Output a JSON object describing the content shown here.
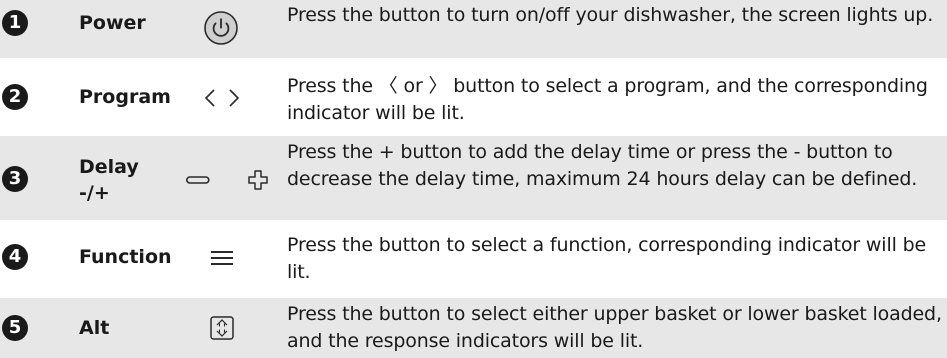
{
  "rows": [
    {
      "number": "1",
      "name": "Power",
      "icon": "power-icon",
      "description": "Press the button to turn on/off your dishwasher, the screen lights up."
    },
    {
      "number": "2",
      "name": "Program",
      "icon": "chevron-left-right-icon",
      "description": "Press the 〈 or 〉 button to select a program, and the corresponding indicator will be lit."
    },
    {
      "number": "3",
      "name_line1": "Delay",
      "name_line2": "-/+",
      "icon": "minus-plus-icon",
      "description": "Press the + button to add the delay time or press the - button to decrease the delay time, maximum 24 hours delay can be defined."
    },
    {
      "number": "4",
      "name": "Function",
      "icon": "menu-icon",
      "description": "Press the button to select a function, corresponding indicator will be lit."
    },
    {
      "number": "5",
      "name": "Alt",
      "icon": "basket-alternate-icon",
      "description": "Press the button to select either upper basket or lower basket loaded, and the response indicators will be lit."
    }
  ],
  "colors": {
    "shaded_row": "#e7e7e7",
    "text": "#1a1a1a",
    "number_badge": "#1a1a1a"
  }
}
